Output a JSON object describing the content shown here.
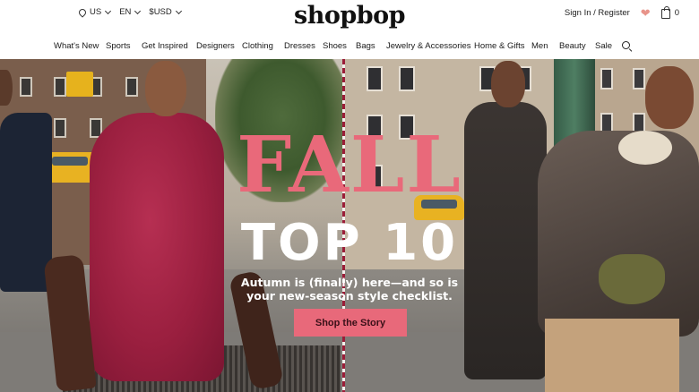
{
  "header": {
    "locale": {
      "country": "US",
      "language": "EN",
      "currency": "$USD"
    },
    "logo": "shopbop",
    "account_link": "Sign In / Register",
    "bag_count": "0"
  },
  "nav": {
    "items": [
      "What's New",
      "Sports",
      "Get Inspired",
      "Designers",
      "Clothing",
      "Dresses",
      "Shoes",
      "Bags",
      "Jewelry & Accessories",
      "Home & Gifts",
      "Men",
      "Beauty",
      "Sale"
    ]
  },
  "hero": {
    "headline_1": "FALL",
    "headline_2": "TOP 10",
    "subtitle_line_1": "Autumn is (finally) here—and so is",
    "subtitle_line_2": "your new-season style checklist.",
    "cta_label": "Shop the Story"
  },
  "colors": {
    "accent_pink": "#e9697a",
    "heart": "#e8948a",
    "dress": "#9a1f3f"
  },
  "icons": [
    "location-pin-icon",
    "chevron-down-icon",
    "heart-icon",
    "shopping-bag-icon",
    "search-icon"
  ]
}
